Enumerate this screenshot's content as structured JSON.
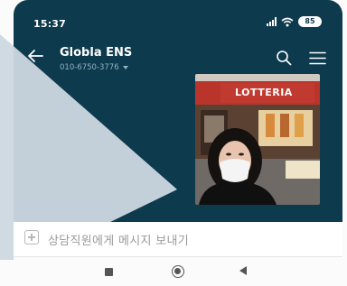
{
  "status_bar": {
    "time": "15:37",
    "battery": "85"
  },
  "header": {
    "title": "Globla ENS",
    "phone": "010-6750-3776"
  },
  "message": {
    "photo_sign_text": "LOTTERIA"
  },
  "input_bar": {
    "placeholder": "상담직원에게 메시지 보내기"
  },
  "colors": {
    "header_bg": "#0e3a4d",
    "accent_subtext": "#8fb3c2",
    "input_bg": "#ffffff"
  },
  "icons": {
    "back": "back-arrow-icon",
    "search": "search-icon",
    "menu": "hamburger-menu-icon",
    "attach": "plus-square-icon",
    "nav_recent": "square-icon",
    "nav_home": "circle-icon",
    "nav_back": "triangle-back-icon"
  }
}
